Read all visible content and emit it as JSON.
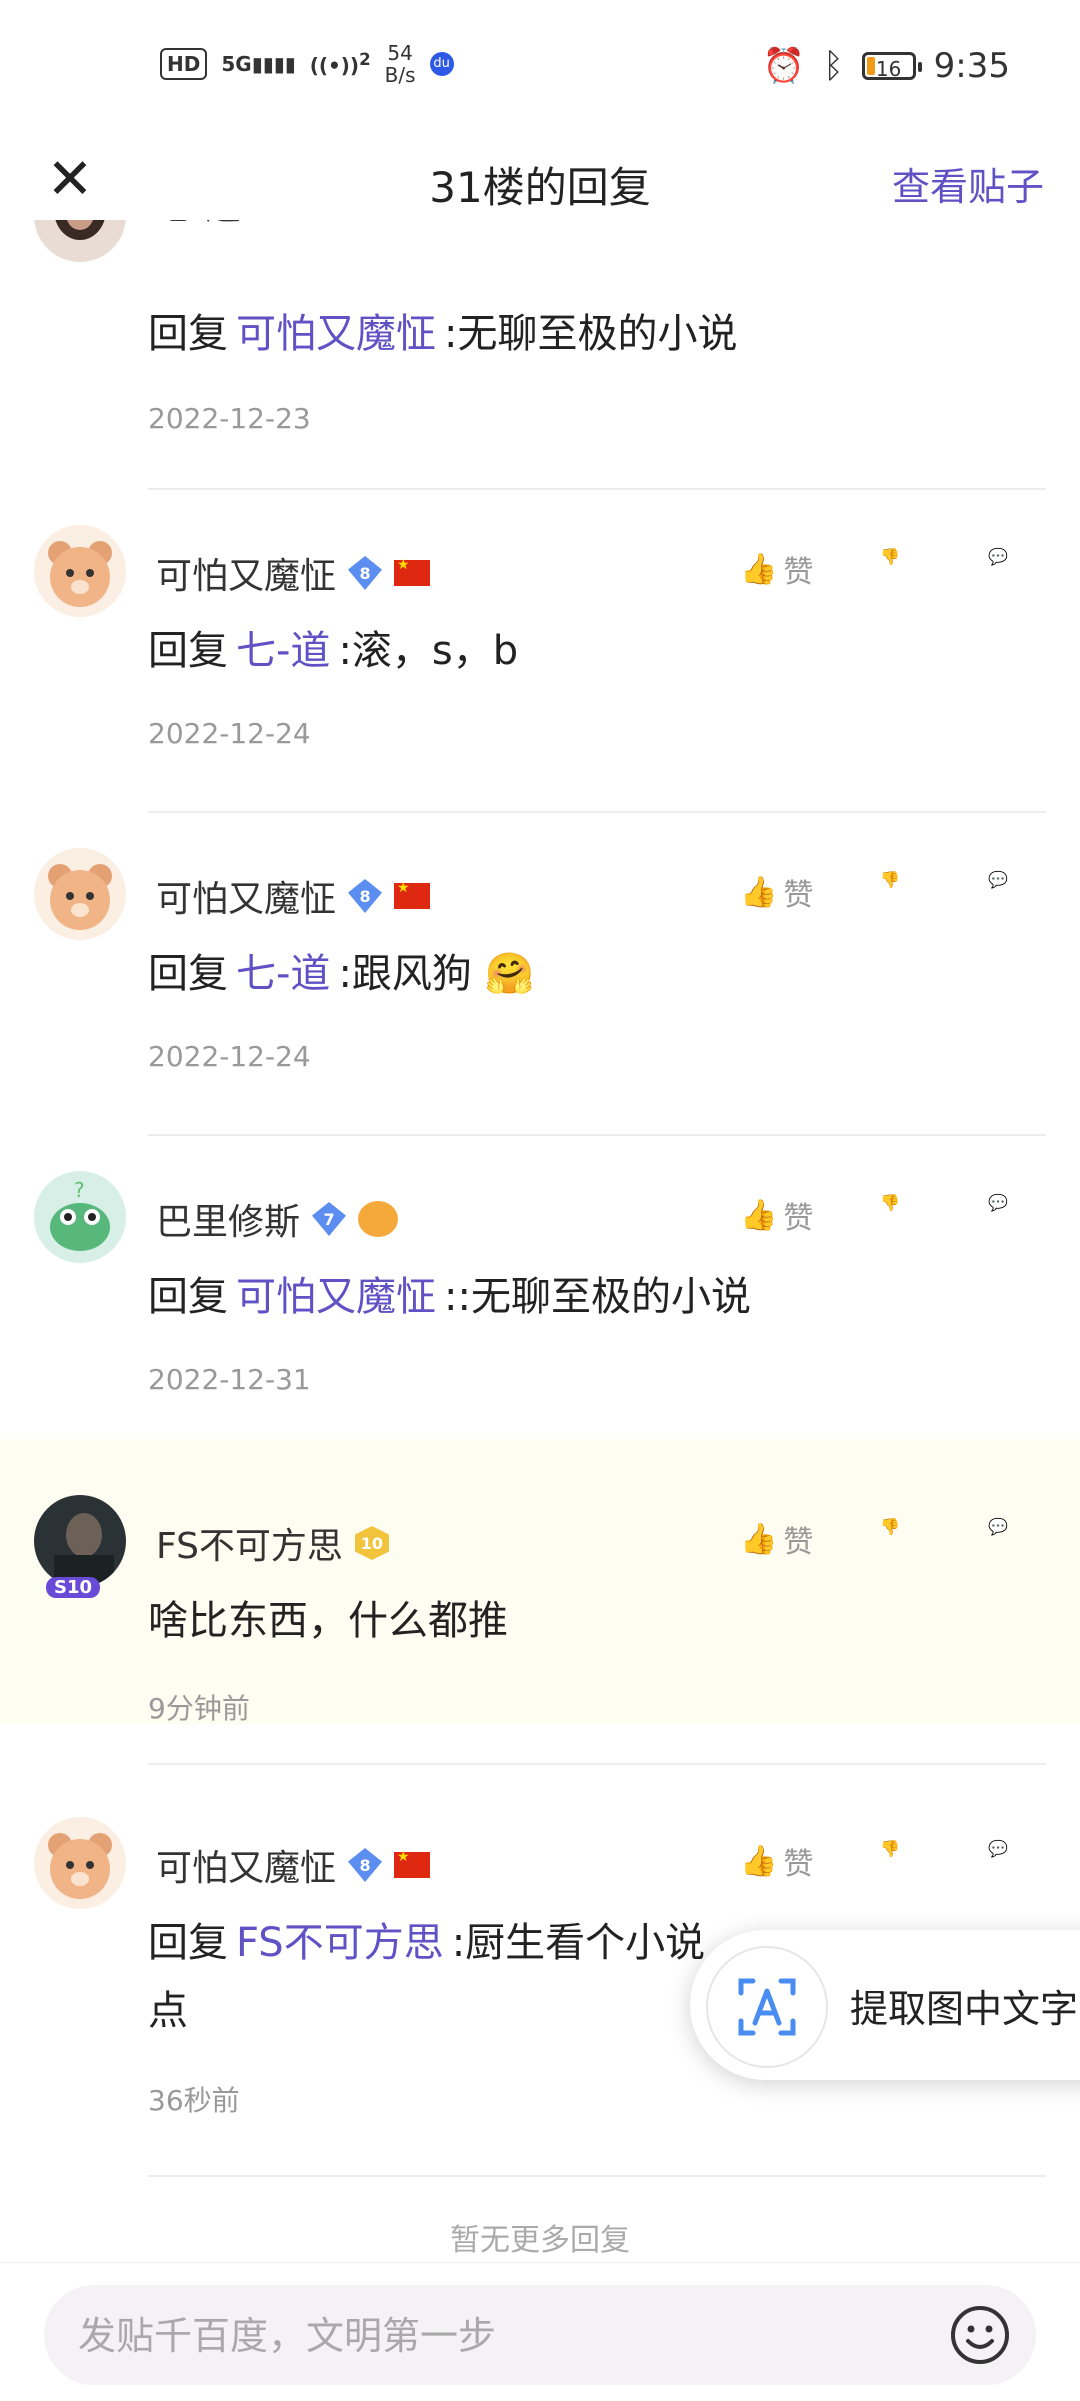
{
  "status_bar": {
    "hd": "HD",
    "network": "5G",
    "hotspot": "2",
    "speed_value": "54",
    "speed_unit": "B/s",
    "battery": "16",
    "time": "9:35"
  },
  "header": {
    "title": "31楼的回复",
    "view_post": "查看贴子"
  },
  "like_label": "赞",
  "replies": [
    {
      "name": "七-道",
      "prefix": "回复",
      "mention": "可怕又魔怔",
      "text": ":无聊至极的小说",
      "time": "2022-12-23"
    },
    {
      "name": "可怕又魔怔",
      "level": "8",
      "prefix": "回复",
      "mention": "七-道",
      "text": ":滚，s，b",
      "time": "2022-12-24"
    },
    {
      "name": "可怕又魔怔",
      "level": "8",
      "prefix": "回复",
      "mention": "七-道",
      "text": ":跟风狗 🤗",
      "time": "2022-12-24"
    },
    {
      "name": "巴里修斯",
      "level": "7",
      "prefix": "回复",
      "mention": "可怕又魔怔",
      "text": "::无聊至极的小说",
      "time": "2022-12-31"
    },
    {
      "name": "FS不可方思",
      "level": "10",
      "text": "啥比东西，什么都推",
      "time": "9分钟前",
      "avatar_badge": "S10"
    },
    {
      "name": "可怕又魔怔",
      "level": "8",
      "prefix": "回复",
      "mention": "FS不可方思",
      "text": ":厨生看个小说",
      "text_line2": "点",
      "time": "36秒前"
    }
  ],
  "footer_note": "暂无更多回复",
  "ocr_popup": {
    "label": "提取图中文字"
  },
  "composer": {
    "placeholder": "发贴千百度，文明第一步"
  },
  "colors": {
    "accent": "#6051c4",
    "highlight_bg": "#fefdf1",
    "secondary_text": "#999999"
  }
}
